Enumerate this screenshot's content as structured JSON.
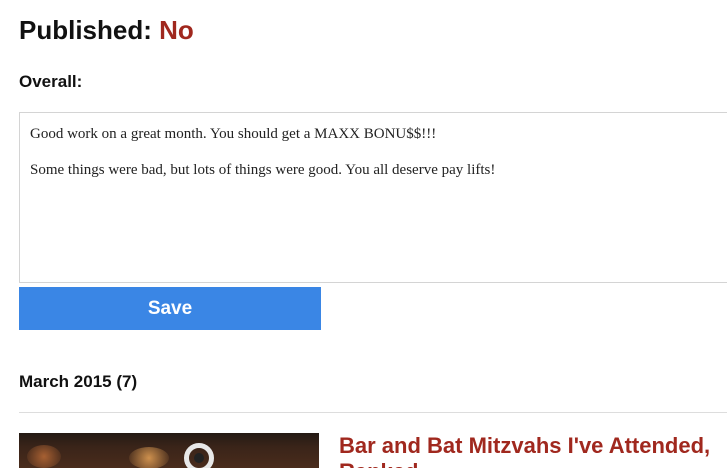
{
  "status": {
    "label": "Published:",
    "value": "No"
  },
  "overall": {
    "label": "Overall:",
    "paragraphs": [
      "Good work on a great month. You should get a MAXX BONU$$!!!",
      "Some things were bad, but lots of things were good. You all deserve pay lifts!"
    ]
  },
  "actions": {
    "save_label": "Save"
  },
  "archive": {
    "month_heading": "March 2015 (7)",
    "posts": [
      {
        "title_line1": "Bar and Bat Mitzvahs I've Attended,",
        "title_line2": "Ranked"
      }
    ]
  },
  "colors": {
    "accent_red": "#a0281e",
    "button_blue": "#3a86e5"
  }
}
